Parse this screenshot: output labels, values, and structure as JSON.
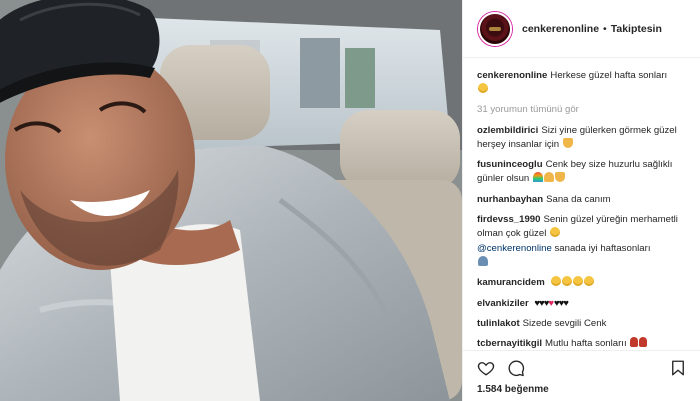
{
  "post": {
    "username": "cenkerenonline",
    "separator": "•",
    "follow_status": "Takiptesin",
    "photo_alt": "selfie"
  },
  "caption": {
    "user": "cenkerenonline",
    "text": "Herkese güzel hafta sonları"
  },
  "view_all_comments": "31 yorumun tümünü gör",
  "comments": [
    {
      "user": "ozlembildirici",
      "text": "Sizi yine gülerken görmek güzel herşey insanlar için"
    },
    {
      "user": "fusuninceoglu",
      "text": "Cenk bey size huzurlu sağlıklı günler olsun"
    },
    {
      "user": "nurhanbayhan",
      "text": "Sana da canım"
    },
    {
      "user": "firdevss_1990",
      "text": "Senin güzel yüreğin merhametli olman çok güzel",
      "mention": "@cenkerenonline",
      "text2": "sanada iyi haftasonları"
    },
    {
      "user": "kamurancidem",
      "text": ""
    },
    {
      "user": "elvankiziler",
      "text": ""
    },
    {
      "user": "tulinlakot",
      "text": "Sizede sevgili Cenk"
    },
    {
      "user": "tcbernayitikgil",
      "text": "Mutlu hafta sonlarıı"
    }
  ],
  "actions": {
    "like_icon": "heart-outline-icon",
    "comment_icon": "speech-bubble-icon",
    "save_icon": "bookmark-icon"
  },
  "likes_text": "1.584 beğenme",
  "colors": {
    "text": "#262626",
    "muted": "#999999",
    "mention": "#003569",
    "border": "#efefef"
  }
}
